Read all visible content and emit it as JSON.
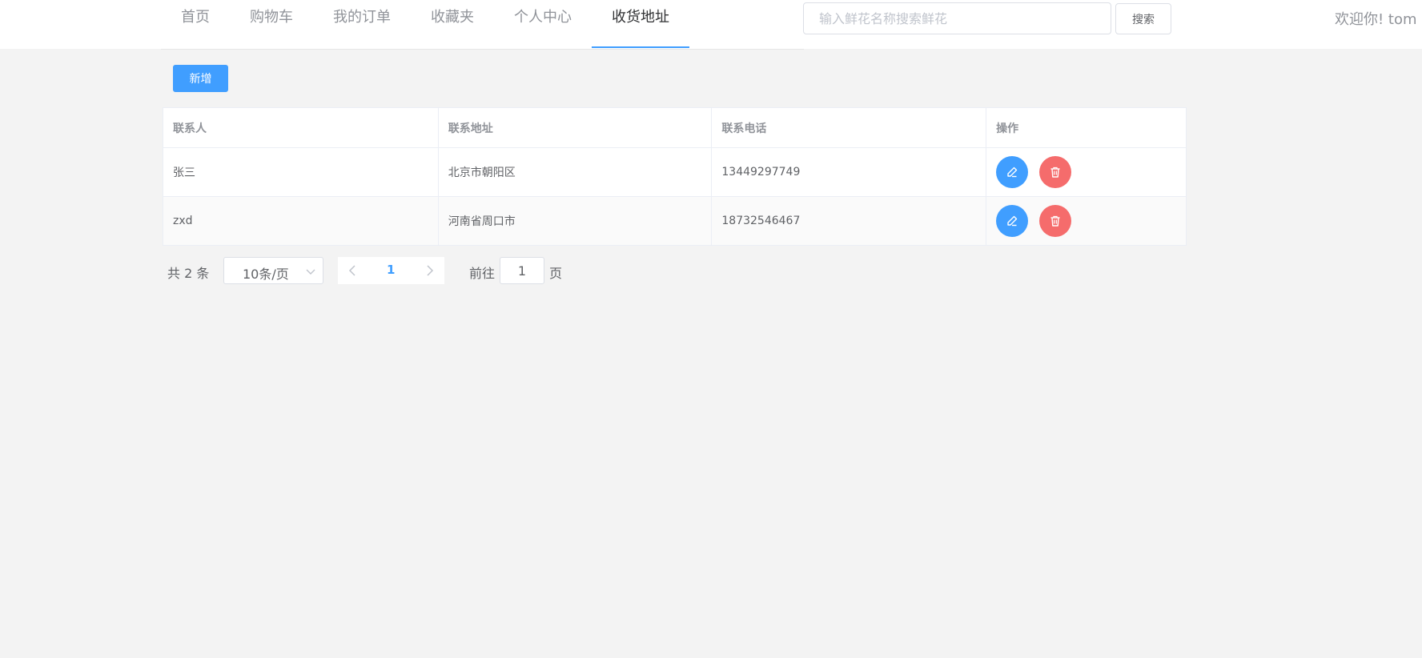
{
  "nav": {
    "items": [
      "首页",
      "购物车",
      "我的订单",
      "收藏夹",
      "个人中心",
      "收货地址"
    ],
    "active_index": 5,
    "accent": "#409eff"
  },
  "search": {
    "placeholder": "输入鲜花名称搜索鲜花",
    "value": "",
    "button_label": "搜索"
  },
  "welcome": "欢迎你!  tom",
  "toolbar": {
    "add_label": "新增"
  },
  "table": {
    "columns": [
      "联系人",
      "联系地址",
      "联系电话",
      "操作"
    ],
    "rows": [
      {
        "name": "张三",
        "address": "北京市朝阳区",
        "phone": "13449297749"
      },
      {
        "name": "zxd",
        "address": "河南省周口市",
        "phone": "18732546467"
      }
    ],
    "actions": {
      "edit_icon": "edit-icon",
      "delete_icon": "trash-icon",
      "edit_color": "#409eff",
      "delete_color": "#f56c6c"
    }
  },
  "pagination": {
    "total_text": "共 2 条",
    "page_size": "10条/页",
    "current_page": "1",
    "goto_label": "前往",
    "goto_value": "1",
    "page_suffix": "页"
  }
}
